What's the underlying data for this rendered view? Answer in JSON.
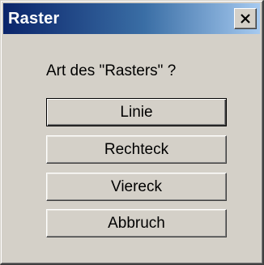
{
  "window": {
    "title": "Raster",
    "close_icon": "close-icon"
  },
  "prompt": {
    "question": "Art des \"Rasters\" ?"
  },
  "buttons": [
    {
      "label": "Linie",
      "default": true
    },
    {
      "label": "Rechteck",
      "default": false
    },
    {
      "label": "Viereck",
      "default": false
    },
    {
      "label": "Abbruch",
      "default": false
    }
  ],
  "colors": {
    "titlebar_start": "#0a246a",
    "titlebar_end": "#a6caf0",
    "face": "#d4d0c8"
  }
}
